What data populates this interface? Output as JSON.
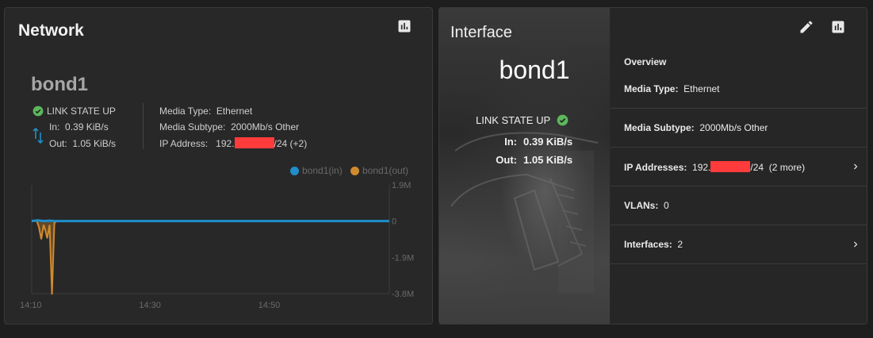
{
  "network_card": {
    "title": "Network",
    "interface_name": "bond1",
    "link_state": "LINK STATE UP",
    "in_label": "In:",
    "in_value": "0.39 KiB/s",
    "out_label": "Out:",
    "out_value": "1.05 KiB/s",
    "media_type_label": "Media Type:",
    "media_type_value": "Ethernet",
    "media_subtype_label": "Media Subtype:",
    "media_subtype_value": "2000Mb/s Other",
    "ip_label": "IP Address:",
    "ip_prefix": "192.",
    "ip_suffix": "/24 (+2)",
    "icons": [
      "chart-icon",
      "check-circle-icon",
      "swap-vertical-icon"
    ]
  },
  "chart_data": {
    "type": "line",
    "x_tick_labels": [
      "14:10",
      "14:30",
      "14:50"
    ],
    "y_tick_labels": [
      "1.9M",
      "0",
      "-1.9M",
      "-3.8M"
    ],
    "ylim": [
      -3.8,
      1.9
    ],
    "y_unit": "M",
    "series": [
      {
        "name": "bond1(in)",
        "color": "#1f8ecb",
        "x": [
          0,
          1,
          2,
          3,
          4,
          5,
          60
        ],
        "y": [
          0,
          0.04,
          0,
          0.02,
          0,
          0,
          0
        ]
      },
      {
        "name": "bond1(out)",
        "color": "#d08a2e",
        "x": [
          0,
          0.8,
          1.2,
          1.6,
          2.0,
          2.3,
          2.6,
          3.0,
          3.4,
          3.8,
          4.2,
          60
        ],
        "y": [
          0,
          0.05,
          -0.3,
          -0.95,
          -0.2,
          -0.5,
          -0.9,
          -0.2,
          -3.85,
          -0.1,
          0,
          0
        ]
      }
    ]
  },
  "interface_card": {
    "heading": "Interface",
    "interface_name": "bond1",
    "link_state": "LINK STATE UP",
    "in_label": "In:",
    "in_value": "0.39 KiB/s",
    "out_label": "Out:",
    "out_value": "1.05 KiB/s",
    "overview_label": "Overview",
    "media_type_label": "Media Type:",
    "media_type_value": "Ethernet",
    "media_subtype_label": "Media Subtype:",
    "media_subtype_value": "2000Mb/s Other",
    "ip_label": "IP Addresses:",
    "ip_prefix": "192.",
    "ip_suffix": "/24",
    "ip_more": "(2 more)",
    "vlans_label": "VLANs:",
    "vlans_value": "0",
    "interfaces_label": "Interfaces:",
    "interfaces_value": "2",
    "icons": [
      "edit-icon",
      "chart-icon",
      "chevron-right-icon"
    ]
  },
  "colors": {
    "success": "#5cb85c",
    "redaction": "#ff3b3b",
    "in_series": "#1f8ecb",
    "out_series": "#d08a2e"
  }
}
